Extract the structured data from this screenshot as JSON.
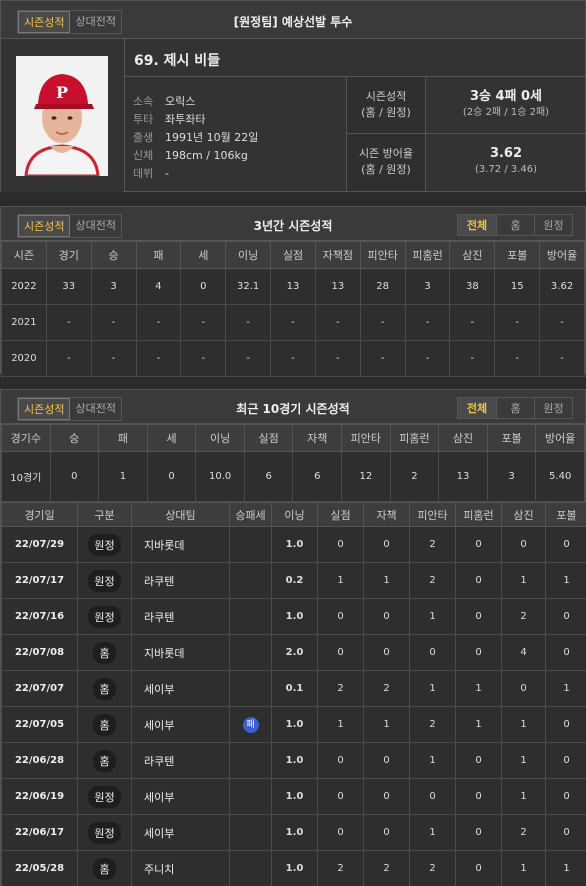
{
  "header": {
    "tab_season": "시즌성적",
    "tab_vs": "상대전적",
    "title": "[원정팀] 예상선발 투수"
  },
  "player": {
    "name": "69. 제시 비들",
    "info": [
      {
        "key": "소속",
        "value": "오릭스"
      },
      {
        "key": "투타",
        "value": "좌투좌타"
      },
      {
        "key": "출생",
        "value": "1991년 10월 22일"
      },
      {
        "key": "신체",
        "value": "198cm / 106kg"
      },
      {
        "key": "데뷔",
        "value": "-"
      }
    ],
    "season_record_label": "시즌성적",
    "season_record_sub": "(홈 / 원정)",
    "season_record_value": "3승 4패 0세",
    "season_record_detail": "(2승 2패 / 1승 2패)",
    "era_label": "시즌 방어율",
    "era_sub": "(홈 / 원정)",
    "era_value": "3.62",
    "era_detail": "(3.72 / 3.46)"
  },
  "three_year": {
    "tab_season": "시즌성적",
    "tab_vs": "상대전적",
    "title": "3년간 시즌성적",
    "filters": [
      "전체",
      "홈",
      "원정"
    ],
    "columns": [
      "시즌",
      "경기",
      "승",
      "패",
      "세",
      "이닝",
      "실점",
      "자책점",
      "피안타",
      "피홈런",
      "삼진",
      "포볼",
      "방어율"
    ],
    "rows": [
      [
        "2022",
        "33",
        "3",
        "4",
        "0",
        "32.1",
        "13",
        "13",
        "28",
        "3",
        "38",
        "15",
        "3.62"
      ],
      [
        "2021",
        "-",
        "-",
        "-",
        "-",
        "-",
        "-",
        "-",
        "-",
        "-",
        "-",
        "-",
        "-"
      ],
      [
        "2020",
        "-",
        "-",
        "-",
        "-",
        "-",
        "-",
        "-",
        "-",
        "-",
        "-",
        "-",
        "-"
      ]
    ]
  },
  "recent": {
    "tab_season": "시즌성적",
    "tab_vs": "상대전적",
    "title": "최근 10경기 시즌성적",
    "filters": [
      "전체",
      "홈",
      "원정"
    ],
    "summary_columns": [
      "경기수",
      "승",
      "패",
      "세",
      "이닝",
      "실점",
      "자책",
      "피안타",
      "피홈런",
      "삼진",
      "포볼",
      "방어율"
    ],
    "summary_row": [
      "10경기",
      "0",
      "1",
      "0",
      "10.0",
      "6",
      "6",
      "12",
      "2",
      "13",
      "3",
      "5.40"
    ],
    "game_columns": [
      "경기일",
      "구분",
      "상대팀",
      "승패세",
      "이닝",
      "실점",
      "자책",
      "피안타",
      "피홈런",
      "삼진",
      "포볼"
    ],
    "games": [
      {
        "date": "22/07/29",
        "type": "원정",
        "opp": "지바롯데",
        "res": "",
        "ip": "1.0",
        "r": "0",
        "er": "0",
        "h": "2",
        "hr": "0",
        "so": "0",
        "bb": "0"
      },
      {
        "date": "22/07/17",
        "type": "원정",
        "opp": "라쿠텐",
        "res": "",
        "ip": "0.2",
        "r": "1",
        "er": "1",
        "h": "2",
        "hr": "0",
        "so": "1",
        "bb": "1"
      },
      {
        "date": "22/07/16",
        "type": "원정",
        "opp": "라쿠텐",
        "res": "",
        "ip": "1.0",
        "r": "0",
        "er": "0",
        "h": "1",
        "hr": "0",
        "so": "2",
        "bb": "0"
      },
      {
        "date": "22/07/08",
        "type": "홈",
        "opp": "지바롯데",
        "res": "",
        "ip": "2.0",
        "r": "0",
        "er": "0",
        "h": "0",
        "hr": "0",
        "so": "4",
        "bb": "0"
      },
      {
        "date": "22/07/07",
        "type": "홈",
        "opp": "세이부",
        "res": "",
        "ip": "0.1",
        "r": "2",
        "er": "2",
        "h": "1",
        "hr": "1",
        "so": "0",
        "bb": "1"
      },
      {
        "date": "22/07/05",
        "type": "홈",
        "opp": "세이부",
        "res": "패",
        "ip": "1.0",
        "r": "1",
        "er": "1",
        "h": "2",
        "hr": "1",
        "so": "1",
        "bb": "0"
      },
      {
        "date": "22/06/28",
        "type": "홈",
        "opp": "라쿠텐",
        "res": "",
        "ip": "1.0",
        "r": "0",
        "er": "0",
        "h": "1",
        "hr": "0",
        "so": "1",
        "bb": "0"
      },
      {
        "date": "22/06/19",
        "type": "원정",
        "opp": "세이부",
        "res": "",
        "ip": "1.0",
        "r": "0",
        "er": "0",
        "h": "0",
        "hr": "0",
        "so": "1",
        "bb": "0"
      },
      {
        "date": "22/06/17",
        "type": "원정",
        "opp": "세이부",
        "res": "",
        "ip": "1.0",
        "r": "0",
        "er": "0",
        "h": "1",
        "hr": "0",
        "so": "2",
        "bb": "0"
      },
      {
        "date": "22/05/28",
        "type": "홈",
        "opp": "주니치",
        "res": "",
        "ip": "1.0",
        "r": "2",
        "er": "2",
        "h": "2",
        "hr": "0",
        "so": "1",
        "bb": "1"
      }
    ]
  },
  "colors": {
    "accent": "#f0c34a",
    "loss_badge": "#3c5fd0"
  }
}
